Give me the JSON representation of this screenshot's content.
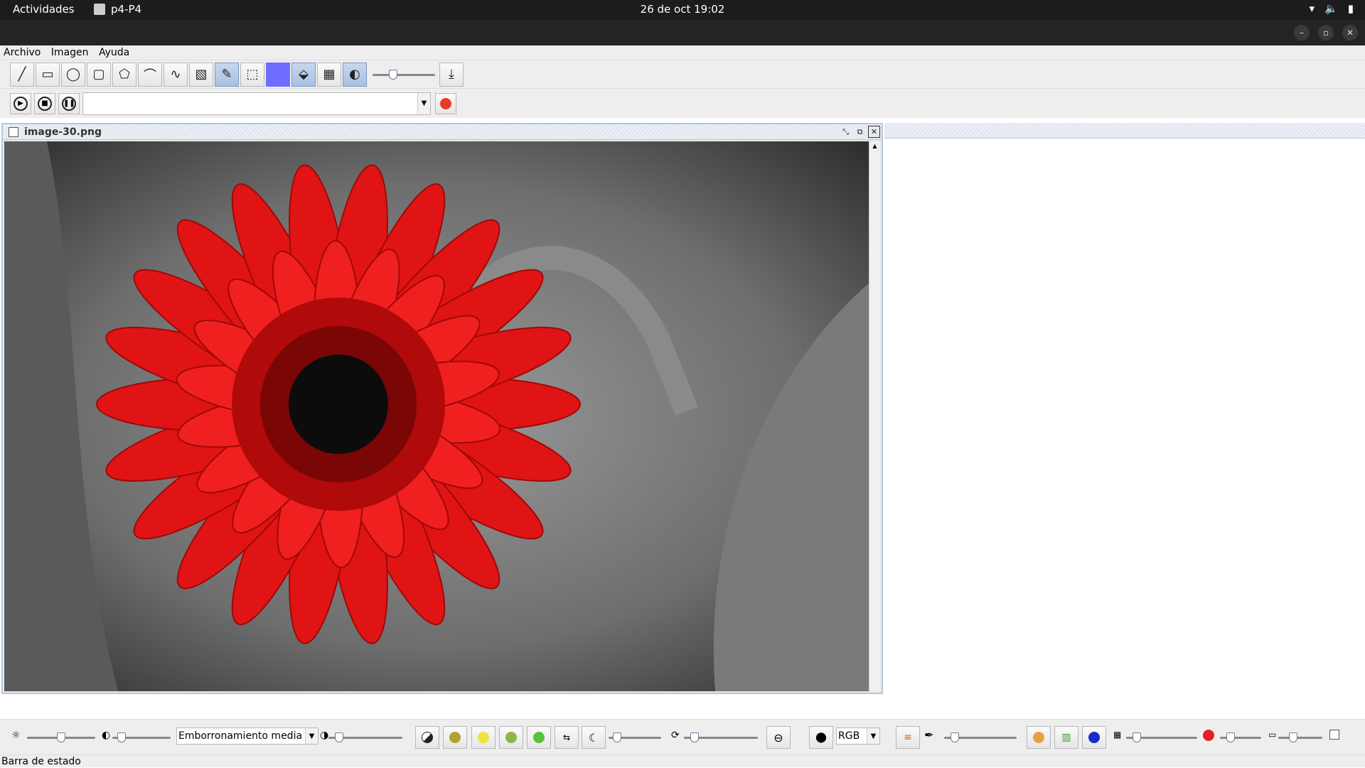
{
  "topbar": {
    "activities": "Actividades",
    "app_name": "p4-P4",
    "clock": "26 de oct  19:02"
  },
  "menu": [
    "Archivo",
    "Imagen",
    "Ayuda"
  ],
  "toolbar": {
    "tools": [
      "line-tool",
      "rectangle-tool",
      "ellipse-tool",
      "rounded-rect-tool",
      "polygon-tool",
      "arc-tool",
      "curve-tool",
      "text-tool",
      "pencil-tool",
      "select-tool"
    ],
    "color_swatch": "#6d6dff",
    "stroke_slider_value": 0.3
  },
  "player": {
    "combo_value": ""
  },
  "document": {
    "title": "image-30.png"
  },
  "bottom": {
    "brightness_value": 0.5,
    "contrast_value": 0.1,
    "filter_combo": "Emborronamiento media",
    "filter_slider_value": 0.1,
    "threshold_value": 0.1,
    "rotate_value": 0.1,
    "color_space": "RGB",
    "tint_value": 0.1,
    "posterize_value": 0.1,
    "red_value": 0.2,
    "sepia_value": 0.3
  },
  "status": "Barra de estado"
}
